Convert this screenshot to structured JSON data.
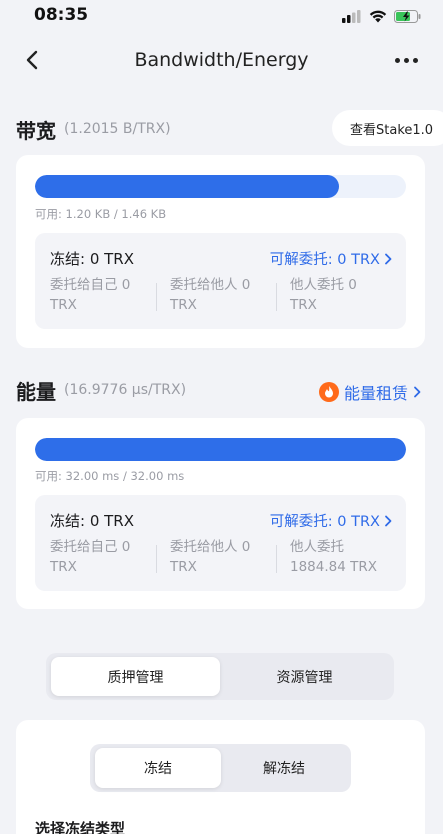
{
  "status": {
    "time": "08:35",
    "icons": [
      "cellular-signal-icon",
      "wifi-icon",
      "battery-charging-icon"
    ]
  },
  "nav": {
    "title": "Bandwidth/Energy",
    "back_icon": "chevron-left-icon",
    "more_icon": "more-horizontal-icon"
  },
  "bandwidth": {
    "title": "带宽",
    "rate": "(1.2015 B/TRX)",
    "stake_button": "查看Stake1.0",
    "usage_text": "可用: 1.20 KB / 1.46 KB",
    "available_fraction": 0.82,
    "frozen": "冻结: 0 TRX",
    "undelegatable": "可解委托: 0 TRX",
    "stats": [
      {
        "line1": "委托给自己 0",
        "line2": "TRX"
      },
      {
        "line1": "委托给他人 0",
        "line2": "TRX"
      },
      {
        "line1": "他人委托 0",
        "line2": "TRX"
      }
    ]
  },
  "energy": {
    "title": "能量",
    "rate": "(16.9776 μs/TRX)",
    "rent_label": "能量租赁",
    "usage_text": "可用: 32.00 ms / 32.00 ms",
    "available_fraction": 1.0,
    "frozen": "冻结: 0 TRX",
    "undelegatable": "可解委托: 0 TRX",
    "stats": [
      {
        "line1": "委托给自己 0",
        "line2": "TRX"
      },
      {
        "line1": "委托给他人 0",
        "line2": "TRX"
      },
      {
        "line1": "他人委托",
        "line2": "1884.84 TRX"
      }
    ]
  },
  "tabs": {
    "stake_manage": "质押管理",
    "resource_manage": "资源管理",
    "active": "stake_manage"
  },
  "freeze_tabs": {
    "freeze": "冻结",
    "unfreeze": "解冻结",
    "active": "freeze"
  },
  "choose_type_label": "选择冻结类型",
  "colors": {
    "accent": "#2e6ee9",
    "link": "#2f6be8",
    "background": "#f2f3f7",
    "flame": "#ff6a1a"
  }
}
